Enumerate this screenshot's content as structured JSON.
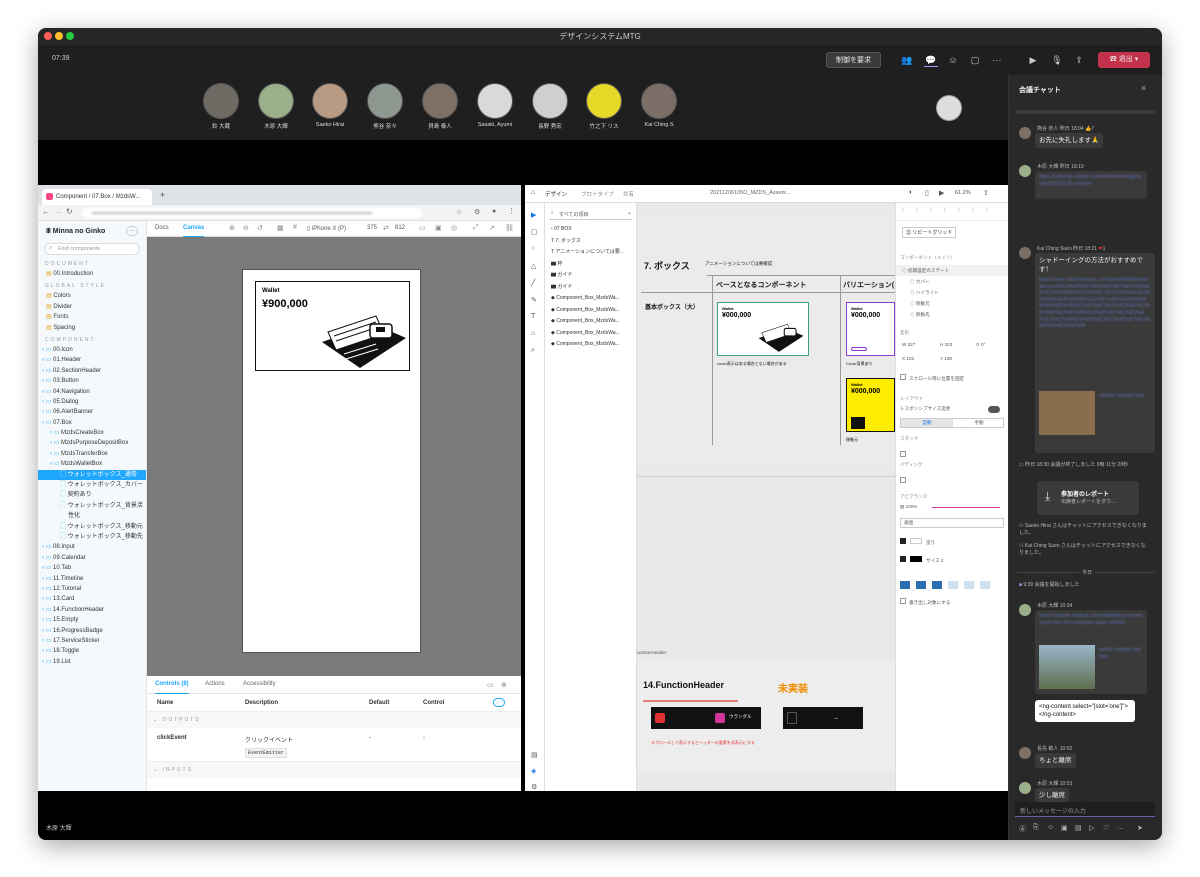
{
  "window": {
    "title": "デザインシステムMTG",
    "clock": "07:39"
  },
  "toolbar": {
    "primary_button": "制御を要求",
    "leave_button": "退出"
  },
  "participants": [
    {
      "name": "鈴 大蔵",
      "color": "#6e6a63"
    },
    {
      "name": "木原 大輝",
      "color": "#9bb08a"
    },
    {
      "name": "Saeko Hirai",
      "color": "#b99a83"
    },
    {
      "name": "熊谷 奈々",
      "color": "#8f9890"
    },
    {
      "name": "貝島 泰人",
      "color": "#7f7066"
    },
    {
      "name": "Sasaki, Ayumi",
      "color": "#d9d9d9"
    },
    {
      "name": "長野 秀宏",
      "color": "#cfcfcf"
    },
    {
      "name": "竹之下 リス",
      "color": "#e6d826"
    },
    {
      "name": "Kai Ching S",
      "color": "#7a6e66"
    }
  ],
  "self_name": "木原 大輝",
  "browser": {
    "tab_title": "Component / 07.Box / MzdsW...",
    "find_placeholder": "Find components",
    "docs_tab": "Docs",
    "canvas_tab": "Canvas",
    "device": "iPhone X (P)",
    "width": "375",
    "height": "812",
    "sidebar": {
      "sec_document": "DOCUMENT",
      "intro": "00.Introduction",
      "sec_global": "GLOBAL STYLE",
      "global": [
        "Colors",
        "Divider",
        "Fonts",
        "Spacing"
      ],
      "sec_component": "COMPONENT",
      "comps_a": [
        "00.Icon",
        "01.Header",
        "02.SectionHeader",
        "03.Button",
        "04.Navigation",
        "05.Dialog",
        "06.AlertBanner",
        "07.Box"
      ],
      "box_children": [
        "MzdsCreateBox",
        "MzdsPurposeDepositBox",
        "MzdsTransferBox",
        "MzdsWalletBox"
      ],
      "wallet_stories": [
        "ウォレットボックス_通常",
        "ウォレットボックス_カバー",
        "契約あり",
        "ウォレットボックス_背景活",
        "性化",
        "ウォレットボックス_移動元",
        "ウォレットボックス_移動先"
      ],
      "comps_b": [
        "08.Input",
        "09.Calendar",
        "10.Tab",
        "11.Timeline",
        "12.Tutorial",
        "13.Card",
        "14.FunctionHeader",
        "15.Empty",
        "16.ProgressBadge",
        "17.ServiceSticker",
        "18.Toggle",
        "19.List"
      ]
    },
    "wallet_label": "Wallet",
    "wallet_amount": "¥900,000",
    "addons": {
      "tabs": [
        "Controls (8)",
        "Actions",
        "Accessibility"
      ],
      "cols": [
        "Name",
        "Description",
        "Default",
        "Control"
      ],
      "outputs": "OUTPUTS",
      "row_name": "clickEvent",
      "row_desc": "クリックイベント",
      "row_type": "EventEmitter",
      "row_default": "-",
      "row_control": "-",
      "inputs": "INPUTS"
    }
  },
  "design": {
    "tabs": [
      "デザイン",
      "プロトタイプ",
      "共有"
    ],
    "file_name": "20211206105O_MZDS_Assets...",
    "zoom": "61.2%",
    "layers_filter": "すべての項目",
    "layers": [
      "07 BOX",
      "7. ボックス",
      "アニメーションについては要…",
      "枠",
      "ガイド",
      "ガイド",
      "Component_Box_MzdsWa...",
      "Component_Box_MzdsWa...",
      "Component_Box_MzdsWa...",
      "Component_Box_MzdsWa...",
      "Component_Box_MzdsWa..."
    ],
    "section_title": "7. ボックス",
    "section_note": "アニメーションについては要確認",
    "col_base": "ベースとなるコンポーネント",
    "col_variation": "バリエーション(",
    "row_label": "基本ボックス（大）",
    "card_label": "Wallet",
    "card_amount": "¥000,000",
    "card_caption": "cover表示はある場合とない場合がある",
    "card_caption2": "Cover背景あり",
    "card_caption3": "移動元",
    "func_frame": "unctionHeader",
    "func_title": "14.FunctionHeader",
    "func_status": "未実装",
    "func_note": "スクロールして表示するとヘッダーの要素を非表示にする",
    "func_badge": "ウラングル",
    "props": {
      "repeat_grid": "リピートグリッド",
      "component_heading": "コンポーネント（メイン）",
      "states": [
        "初期設定のステート",
        "カバー",
        "ハイライト",
        "移動元",
        "移動先"
      ],
      "transform_heading": "変形",
      "w": "327",
      "h": "323",
      "x": "102",
      "y": "188",
      "rot": "0°",
      "scroll_fix": "スクロール時に位置を固定",
      "layout_heading": "レイアウト",
      "responsive": "レスポンシブサイズ変更",
      "auto": "自動",
      "manual": "手動",
      "stack": "スタック",
      "padding": "パディング",
      "appearance": "アピアランス",
      "opacity": "100%",
      "blend": "通過",
      "fill_label": "塗り",
      "size": "2",
      "export_label": "書き出し対象にする"
    }
  },
  "chat": {
    "title": "会議チャット",
    "messages": [
      {
        "name": "熊谷 奈人",
        "time": "昨日 18:04",
        "text": "お先に失礼します🙏",
        "reaction": "7"
      },
      {
        "name": "木原 大輝",
        "time": "昨日 18:10",
        "text": ""
      },
      {
        "name": "Kai Ching Suen",
        "time": "昨日 18:21",
        "text": "シャドーイングの方法がおすすめです！",
        "reaction": "1"
      }
    ],
    "meeting_end": "昨日 18:30 会議が終了しました 9時 11分 28秒",
    "report_title": "参加者のレポート",
    "report_sub": "出席者レポートをダウ…",
    "left_1": "Saeko Hirai さんはチャットにアクセスできなくなりました。",
    "left_2": "Kai Ching Suen さんはチャットにアクセスできなくなりました。",
    "today": "今日",
    "meeting_start": "9:39 会議を開始しました",
    "msg4": {
      "name": "木原 大輝",
      "time": "10:34"
    },
    "code_msg": "<ng-content select=\"[slot='one']\"></ng-content>",
    "msg5": {
      "name": "長島 敏人",
      "time": "10:52",
      "text": "ちょと離席"
    },
    "msg6": {
      "name": "木原 大輝",
      "time": "10:53",
      "text": "少し離席"
    },
    "input_placeholder": "新しいメッセージの入力"
  },
  "colors": {
    "accent": "#e8a71b",
    "teams_purple": "#6264a7",
    "leave_red": "#c4314b",
    "storybook_blue": "#1ea7fd"
  }
}
